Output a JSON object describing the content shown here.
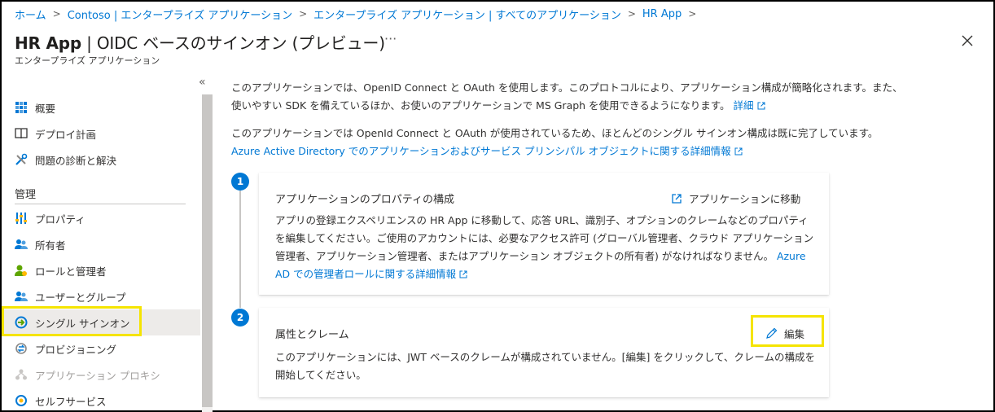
{
  "breadcrumb": [
    {
      "label": "ホーム"
    },
    {
      "label": "Contoso | エンタープライズ アプリケーション"
    },
    {
      "label": "エンタープライズ アプリケーション | すべてのアプリケーション"
    },
    {
      "label": "HR App"
    }
  ],
  "header": {
    "title_app": "HR App",
    "title_rest": " | OIDC ベースのサインオン (プレビュー)",
    "more": "···",
    "subtitle": "エンタープライズ アプリケーション"
  },
  "sidebar": {
    "collapse": "«",
    "items": [
      {
        "label": "概要",
        "icon": "grid-icon"
      },
      {
        "label": "デプロイ計画",
        "icon": "book-icon"
      },
      {
        "label": "問題の診断と解決",
        "icon": "tools-icon"
      },
      {
        "label": "プロパティ",
        "icon": "properties-icon"
      },
      {
        "label": "所有者",
        "icon": "people-icon"
      },
      {
        "label": "ロールと管理者",
        "icon": "user-admin-icon"
      },
      {
        "label": "ユーザーとグループ",
        "icon": "people-icon"
      },
      {
        "label": "シングル サインオン",
        "icon": "sso-icon"
      },
      {
        "label": "プロビジョニング",
        "icon": "provisioning-icon"
      },
      {
        "label": "アプリケーション プロキシ",
        "icon": "proxy-icon"
      },
      {
        "label": "セルフサービス",
        "icon": "self-service-icon"
      }
    ],
    "section_manage": "管理",
    "selected_index": 7
  },
  "main": {
    "intro1_text": "このアプリケーションでは、OpenID Connect と OAuth を使用します。このプロトコルにより、アプリケーション構成が簡略化されます。また、使いやすい SDK を備えているほか、お使いのアプリケーションで MS Graph を使用できるようになります。",
    "intro1_link": "詳細",
    "intro2_text": "このアプリケーションでは OpenId Connect と OAuth が使用されているため、ほとんどのシングル サインオン構成は既に完了しています。",
    "intro2_link": "Azure Active Directory でのアプリケーションおよびサービス プリンシパル オブジェクトに関する詳細情報",
    "step1": {
      "number": "1",
      "title": "アプリケーションのプロパティの構成",
      "action": "アプリケーションに移動",
      "body": "アプリの登録エクスペリエンスの HR App に移動して、応答 URL、識別子、オプションのクレームなどのプロパティを編集してください。ご使用のアカウントには、必要なアクセス許可 (グローバル管理者、クラウド アプリケーション管理者、アプリケーション管理者、またはアプリケーション オブジェクトの所有者) がなければなりません。",
      "link": "Azure AD での管理者ロールに関する詳細情報"
    },
    "step2": {
      "number": "2",
      "title": "属性とクレーム",
      "action": "編集",
      "body": "このアプリケーションには、JWT ベースのクレームが構成されていません。[編集] をクリックして、クレームの構成を開始してください。"
    }
  },
  "colors": {
    "accent": "#0078d4",
    "highlight": "#f5e400",
    "selected_bg": "#edebe9"
  }
}
